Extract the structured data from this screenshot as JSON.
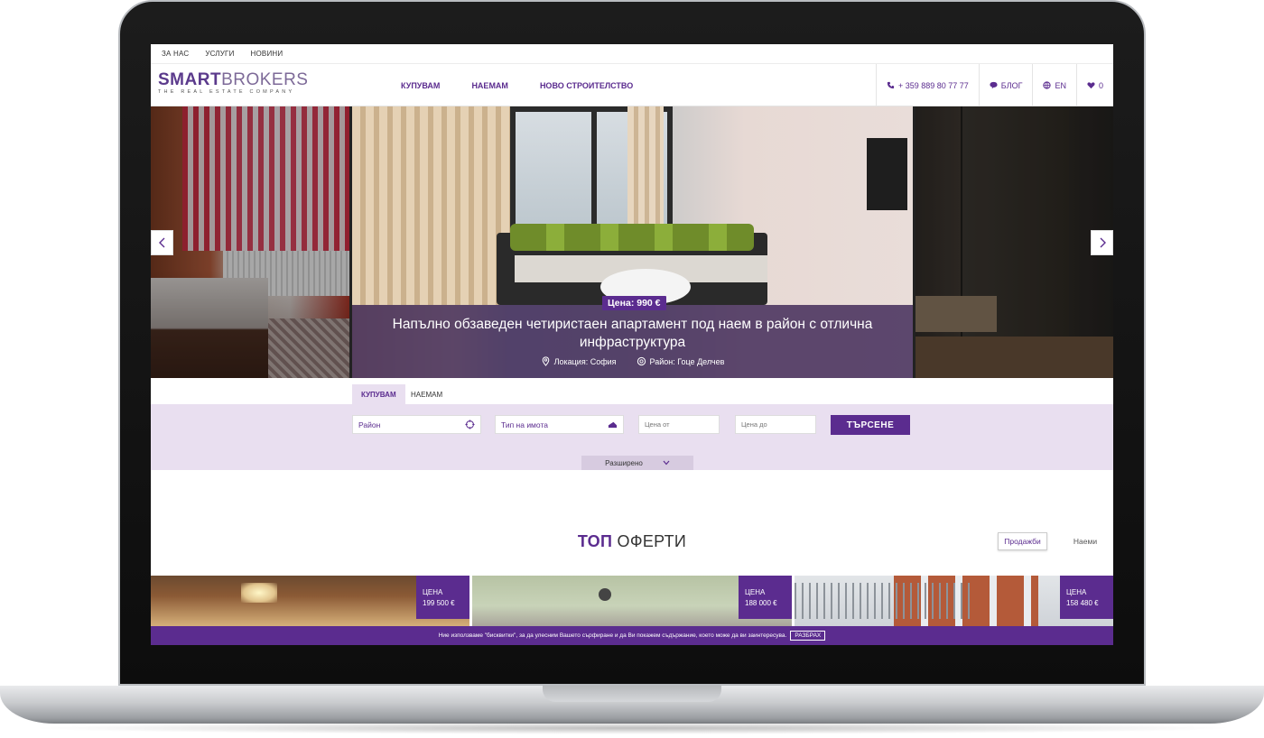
{
  "topbar": {
    "links": [
      "ЗА НАС",
      "УСЛУГИ",
      "НОВИНИ"
    ]
  },
  "logo": {
    "bold": "SMART",
    "light": "BROKERS",
    "tagline": "THE REAL ESTATE COMPANY"
  },
  "nav": {
    "items": [
      "КУПУВАМ",
      "НАЕМАМ",
      "НОВО СТРОИТЕЛСТВО"
    ]
  },
  "header_right": {
    "phone": "+ 359 889 80 77 77",
    "blog": "БЛОГ",
    "lang": "EN",
    "favorites": "0"
  },
  "hero": {
    "price": "Цена: 990 €",
    "title": "Напълно обзаведен четиристаен апартамент под наем в район с отлична инфраструктура",
    "location": "Локация: София",
    "district": "Район: Гоце Делчев"
  },
  "search": {
    "tabs": [
      "КУПУВАМ",
      "НАЕМАМ"
    ],
    "district": "Район",
    "property_type": "Тип на имота",
    "price_from": "Цена от",
    "price_to": "Цена до",
    "button": "ТЪРСЕНЕ",
    "advanced": "Разширено"
  },
  "offers": {
    "heading_bold": "ТОП",
    "heading_light": "ОФЕРТИ",
    "tabs": [
      "Продажби",
      "Наеми"
    ],
    "cards": [
      {
        "price_label": "ЦЕНА",
        "price": "199 500 €"
      },
      {
        "price_label": "ЦЕНА",
        "price": "188 000 €"
      },
      {
        "price_label": "ЦЕНА",
        "price": "158 480 €"
      }
    ]
  },
  "cookie": {
    "text": "Ние използваме \"бисквитки\", за да улесним Вашето сърфиране и да Ви покажем съдържание, което може да ви заинтересува.",
    "button": "РАЗБРАХ"
  },
  "colors": {
    "brand": "#5b2c8f",
    "search_bg": "#e9dff0"
  }
}
